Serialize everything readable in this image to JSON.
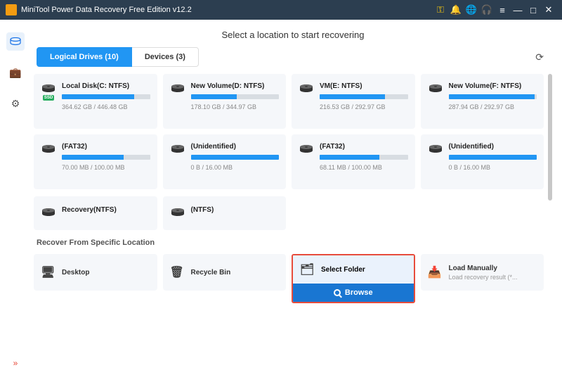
{
  "titlebar": {
    "title": "MiniTool Power Data Recovery Free Edition v12.2"
  },
  "heading": "Select a location to start recovering",
  "tabs": {
    "logical": "Logical Drives (10)",
    "devices": "Devices (3)"
  },
  "drives": [
    {
      "name": "Local Disk(C: NTFS)",
      "size": "364.62 GB / 446.48 GB",
      "fill": 82,
      "ssd": true
    },
    {
      "name": "New Volume(D: NTFS)",
      "size": "178.10 GB / 344.97 GB",
      "fill": 52
    },
    {
      "name": "VM(E: NTFS)",
      "size": "216.53 GB / 292.97 GB",
      "fill": 74
    },
    {
      "name": "New Volume(F: NTFS)",
      "size": "287.94 GB / 292.97 GB",
      "fill": 98
    },
    {
      "name": "(FAT32)",
      "size": "70.00 MB / 100.00 MB",
      "fill": 70
    },
    {
      "name": "(Unidentified)",
      "size": "0 B / 16.00 MB",
      "fill": 100
    },
    {
      "name": "(FAT32)",
      "size": "68.11 MB / 100.00 MB",
      "fill": 68
    },
    {
      "name": "(Unidentified)",
      "size": "0 B / 16.00 MB",
      "fill": 100
    }
  ],
  "drives_short": [
    {
      "name": "Recovery(NTFS)"
    },
    {
      "name": "(NTFS)"
    }
  ],
  "section_title": "Recover From Specific Location",
  "locations": {
    "desktop": "Desktop",
    "recycle": "Recycle Bin",
    "select_folder": "Select Folder",
    "load_manually": "Load Manually",
    "load_sub": "Load recovery result (*...",
    "browse": "Browse"
  }
}
